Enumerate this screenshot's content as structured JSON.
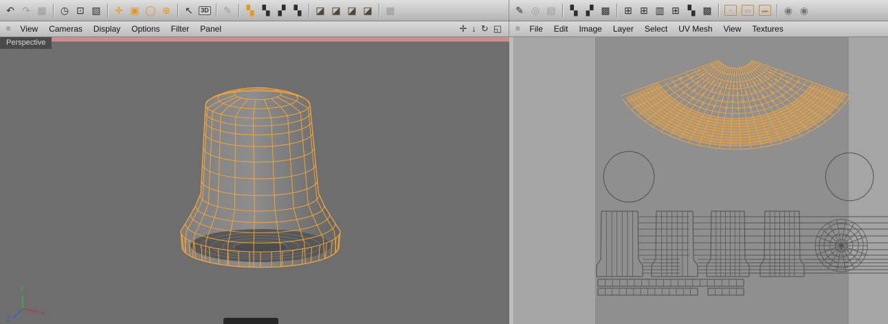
{
  "left_panel": {
    "menubar": {
      "items": [
        "View",
        "Cameras",
        "Display",
        "Options",
        "Filter",
        "Panel"
      ]
    },
    "view_controls": [
      {
        "name": "pan-view",
        "glyph": "✛"
      },
      {
        "name": "zoom-view",
        "glyph": "↓"
      },
      {
        "name": "rotate-view",
        "glyph": "↻"
      },
      {
        "name": "toggle-view",
        "glyph": "◱"
      }
    ],
    "view_label": "Perspective",
    "axis_labels": {
      "x": "X",
      "y": "Y",
      "z": "Z"
    }
  },
  "right_panel": {
    "menubar": {
      "items": [
        "File",
        "Edit",
        "Image",
        "Layer",
        "Select",
        "UV Mesh",
        "View",
        "Textures"
      ]
    }
  },
  "toolbar_left": {
    "items": [
      {
        "name": "undo",
        "glyph": "↶",
        "variant": "dark"
      },
      {
        "name": "redo",
        "glyph": "↷",
        "variant": "disabled"
      },
      {
        "name": "history-grid",
        "glyph": "▦",
        "variant": "disabled"
      },
      {
        "sep": true
      },
      {
        "name": "navigation-rotate",
        "glyph": "◷",
        "variant": "dark"
      },
      {
        "name": "live-selection",
        "glyph": "⊡",
        "variant": "dark"
      },
      {
        "name": "rectangle-selection",
        "glyph": "▧",
        "variant": "dark"
      },
      {
        "sep": true
      },
      {
        "name": "move-tool",
        "glyph": "✛",
        "variant": "orange"
      },
      {
        "name": "scale-tool",
        "glyph": "▣",
        "variant": "orange"
      },
      {
        "name": "rotate-tool",
        "glyph": "◯",
        "variant": "orange"
      },
      {
        "name": "axis-lock",
        "glyph": "⊕",
        "variant": "orange"
      },
      {
        "sep": true
      },
      {
        "name": "pointer-tool",
        "glyph": "↖",
        "variant": "dark"
      },
      {
        "name": "mode-3d",
        "glyph": "3D",
        "variant": "badge"
      },
      {
        "sep": true
      },
      {
        "name": "paint-brush",
        "glyph": "✎",
        "variant": "disabled"
      },
      {
        "sep": true
      },
      {
        "name": "uv-checker-ball-1",
        "glyph": "▚",
        "variant": "orange"
      },
      {
        "name": "uv-checker-ball-2",
        "glyph": "▚",
        "variant": "dark"
      },
      {
        "name": "uv-checker-ball-3",
        "glyph": "▞",
        "variant": "dark"
      },
      {
        "name": "uv-checker-ball-4",
        "glyph": "▚",
        "variant": "dark"
      },
      {
        "sep": true
      },
      {
        "name": "cube-view-1",
        "glyph": "◪",
        "variant": "cube"
      },
      {
        "name": "cube-view-2",
        "glyph": "◪",
        "variant": "cube"
      },
      {
        "name": "cube-view-3",
        "glyph": "◪",
        "variant": "cube"
      },
      {
        "name": "cube-view-4",
        "glyph": "◪",
        "variant": "cube"
      },
      {
        "sep": true
      },
      {
        "name": "grid-options",
        "glyph": "▦",
        "variant": "disabled"
      }
    ]
  },
  "toolbar_right": {
    "items": [
      {
        "name": "uv-paint-brush",
        "glyph": "✎",
        "variant": "dark"
      },
      {
        "name": "uv-clone",
        "glyph": "◎",
        "variant": "disabled"
      },
      {
        "name": "uv-pattern",
        "glyph": "▤",
        "variant": "disabled"
      },
      {
        "sep": true
      },
      {
        "name": "checker-small",
        "glyph": "▚",
        "variant": "dark"
      },
      {
        "name": "checker-medium",
        "glyph": "▞",
        "variant": "dark"
      },
      {
        "name": "checker-large",
        "glyph": "▩",
        "variant": "dark"
      },
      {
        "sep": true
      },
      {
        "name": "uv-projection-1",
        "glyph": "⊞",
        "variant": "dark"
      },
      {
        "name": "uv-projection-2",
        "glyph": "⊞",
        "variant": "dark"
      },
      {
        "name": "uv-projection-3",
        "glyph": "▥",
        "variant": "dark"
      },
      {
        "name": "uv-projection-4",
        "glyph": "⊞",
        "variant": "dark"
      },
      {
        "name": "uv-checker-map",
        "glyph": "▚",
        "variant": "dark"
      },
      {
        "name": "uv-grid-map",
        "glyph": "▩",
        "variant": "dark"
      },
      {
        "sep": true
      },
      {
        "name": "uv-point-mode",
        "glyph": "▫",
        "variant": "outline"
      },
      {
        "name": "uv-edge-mode",
        "glyph": "▭",
        "variant": "outline"
      },
      {
        "name": "uv-polygon-mode",
        "glyph": "▬",
        "variant": "outline"
      },
      {
        "sep": true
      },
      {
        "name": "material-sphere-1",
        "glyph": "◉",
        "variant": "gray"
      },
      {
        "name": "material-sphere-2",
        "glyph": "◉",
        "variant": "gray"
      }
    ]
  },
  "colors": {
    "wire_orange": "#F2A43C",
    "accent_orange": "#E8971E",
    "uv_line": "#4E4E4E",
    "viewport_bg": "#6E6E6E",
    "canvas_bg": "#8F8F8F",
    "active_strip": "#C98F8F"
  }
}
